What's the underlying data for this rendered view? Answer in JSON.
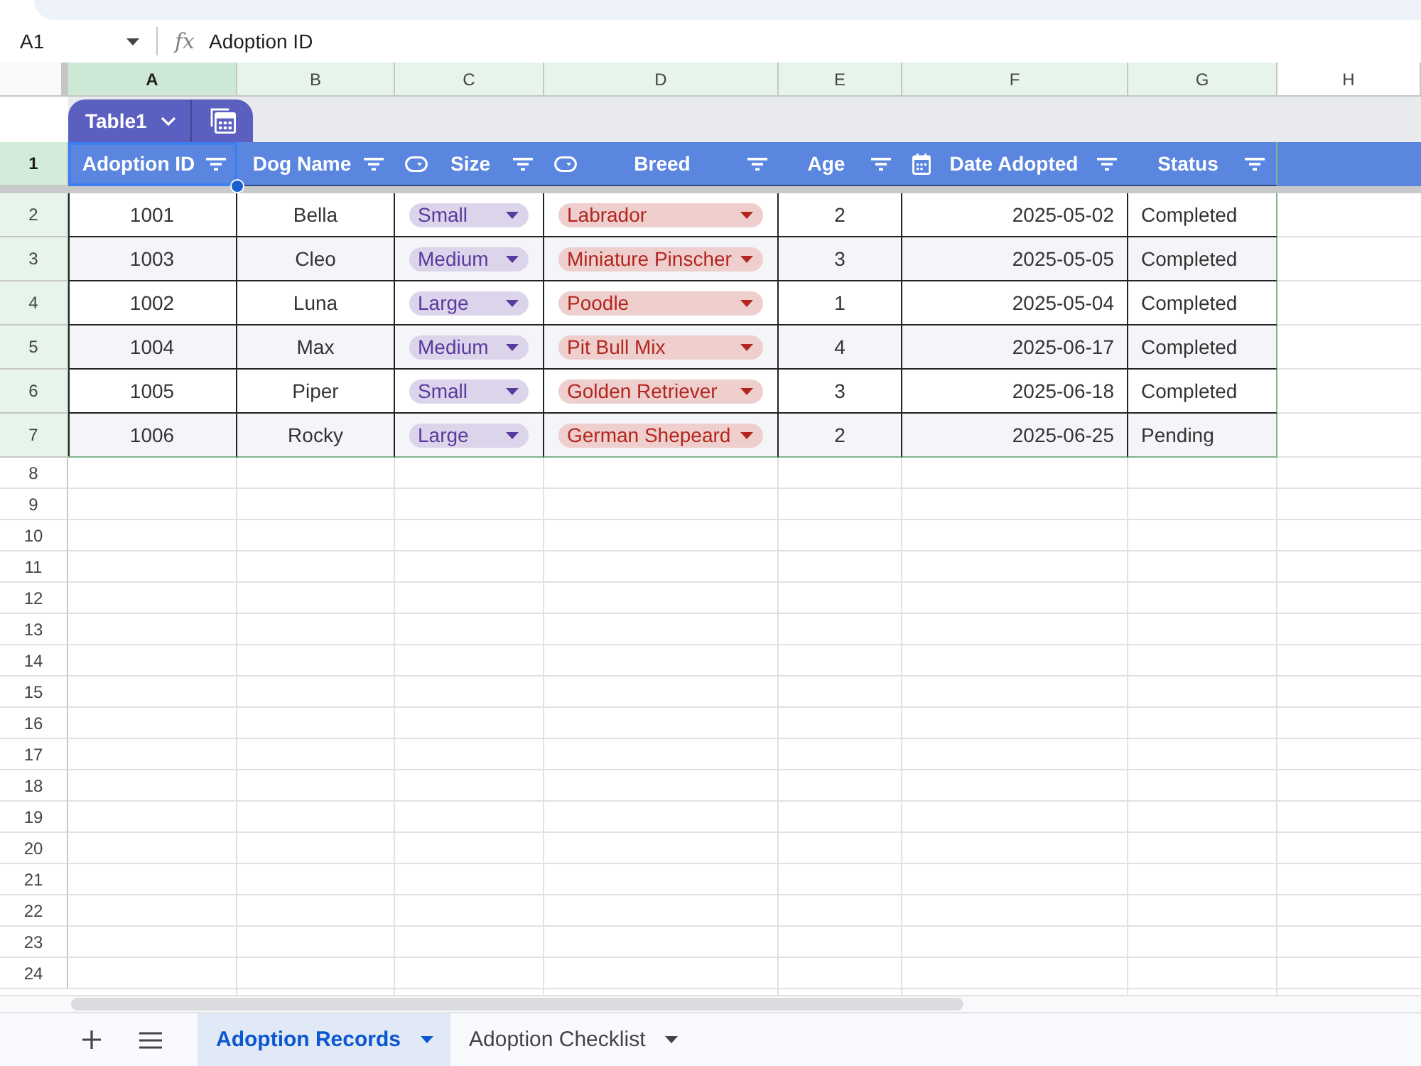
{
  "formula_bar": {
    "cell_reference": "A1",
    "function_symbol": "fx",
    "value": "Adoption ID"
  },
  "column_headers": [
    {
      "label": "A",
      "selected": true,
      "in_table": true
    },
    {
      "label": "B",
      "selected": false,
      "in_table": true
    },
    {
      "label": "C",
      "selected": false,
      "in_table": true
    },
    {
      "label": "D",
      "selected": false,
      "in_table": true
    },
    {
      "label": "E",
      "selected": false,
      "in_table": true
    },
    {
      "label": "F",
      "selected": false,
      "in_table": true
    },
    {
      "label": "G",
      "selected": false,
      "in_table": true
    },
    {
      "label": "H",
      "selected": false,
      "in_table": false
    }
  ],
  "table": {
    "name": "Table1",
    "columns": [
      {
        "label": "Adoption ID",
        "kind": "text"
      },
      {
        "label": "Dog Name",
        "kind": "text"
      },
      {
        "label": "Size",
        "kind": "dropdown",
        "color": "#5b3a9e"
      },
      {
        "label": "Breed",
        "kind": "dropdown",
        "color": "#b3261e"
      },
      {
        "label": "Age",
        "kind": "text"
      },
      {
        "label": "Date Adopted",
        "kind": "date"
      },
      {
        "label": "Status",
        "kind": "text"
      }
    ],
    "rows": [
      {
        "cells": [
          "1001",
          "Bella",
          "Small",
          "Labrador",
          "2",
          "2025-05-02",
          "Completed"
        ]
      },
      {
        "cells": [
          "1003",
          "Cleo",
          "Medium",
          "Miniature Pinscher",
          "3",
          "2025-05-05",
          "Completed"
        ]
      },
      {
        "cells": [
          "1002",
          "Luna",
          "Large",
          "Poodle",
          "1",
          "2025-05-04",
          "Completed"
        ]
      },
      {
        "cells": [
          "1004",
          "Max",
          "Medium",
          "Pit Bull Mix",
          "4",
          "2025-06-17",
          "Completed"
        ]
      },
      {
        "cells": [
          "1005",
          "Piper",
          "Small",
          "Golden Retriever",
          "3",
          "2025-06-18",
          "Completed"
        ]
      },
      {
        "cells": [
          "1006",
          "Rocky",
          "Large",
          "German Shepeard",
          "2",
          "2025-06-25",
          "Pending"
        ]
      }
    ]
  },
  "row_headers": [
    {
      "label": "1",
      "selected": true,
      "in_table": true
    },
    {
      "label": "2",
      "selected": false,
      "in_table": true
    },
    {
      "label": "3",
      "selected": false,
      "in_table": true
    },
    {
      "label": "4",
      "selected": false,
      "in_table": true
    },
    {
      "label": "5",
      "selected": false,
      "in_table": true
    },
    {
      "label": "6",
      "selected": false,
      "in_table": true
    },
    {
      "label": "7",
      "selected": false,
      "in_table": true
    },
    {
      "label": "8",
      "selected": false,
      "in_table": false
    },
    {
      "label": "9",
      "selected": false,
      "in_table": false
    },
    {
      "label": "10",
      "selected": false,
      "in_table": false
    },
    {
      "label": "11",
      "selected": false,
      "in_table": false
    },
    {
      "label": "12",
      "selected": false,
      "in_table": false
    },
    {
      "label": "13",
      "selected": false,
      "in_table": false
    },
    {
      "label": "14",
      "selected": false,
      "in_table": false
    },
    {
      "label": "15",
      "selected": false,
      "in_table": false
    },
    {
      "label": "16",
      "selected": false,
      "in_table": false
    },
    {
      "label": "17",
      "selected": false,
      "in_table": false
    },
    {
      "label": "18",
      "selected": false,
      "in_table": false
    },
    {
      "label": "19",
      "selected": false,
      "in_table": false
    },
    {
      "label": "20",
      "selected": false,
      "in_table": false
    },
    {
      "label": "21",
      "selected": false,
      "in_table": false
    },
    {
      "label": "22",
      "selected": false,
      "in_table": false
    },
    {
      "label": "23",
      "selected": false,
      "in_table": false
    },
    {
      "label": "24",
      "selected": false,
      "in_table": false
    }
  ],
  "sheet_tabs": [
    {
      "label": "Adoption Records",
      "selected": true
    },
    {
      "label": "Adoption Checklist",
      "selected": false
    }
  ]
}
